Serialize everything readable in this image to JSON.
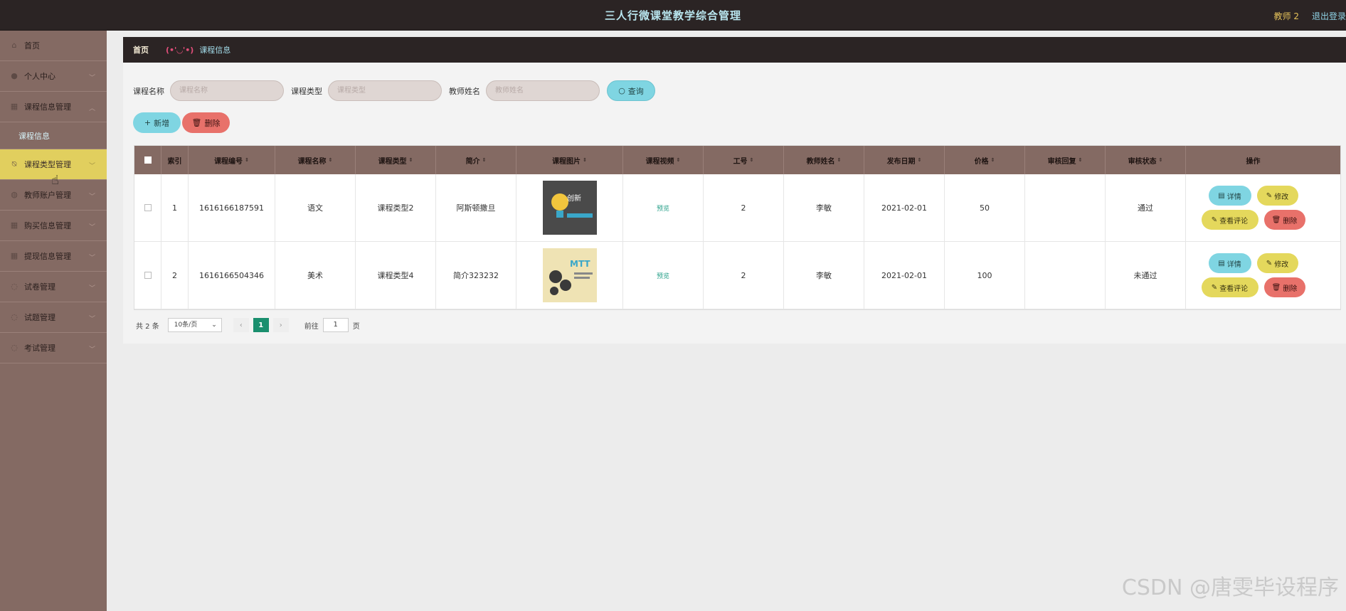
{
  "app": {
    "title": "三人行微课堂教学综合管理",
    "user": "教师 2",
    "logout": "退出登录"
  },
  "sidebar": {
    "items": [
      {
        "label": "首页",
        "icon": "home-icon"
      },
      {
        "label": "个人中心",
        "icon": "user-icon"
      },
      {
        "label": "课程信息管理",
        "icon": "grid-icon"
      },
      {
        "label": "课程信息",
        "icon": ""
      },
      {
        "label": "课程类型管理",
        "icon": "bell-off-icon"
      },
      {
        "label": "教师账户管理",
        "icon": "users-icon"
      },
      {
        "label": "购买信息管理",
        "icon": "grid-icon"
      },
      {
        "label": "提现信息管理",
        "icon": "grid-icon"
      },
      {
        "label": "试卷管理",
        "icon": "doc-icon"
      },
      {
        "label": "试题管理",
        "icon": "doc-icon"
      },
      {
        "label": "考试管理",
        "icon": "doc-icon"
      }
    ]
  },
  "breadcrumb": {
    "home": "首页",
    "face": "(•'◡'•)",
    "current": "课程信息"
  },
  "search": {
    "course_name_label": "课程名称",
    "course_name_placeholder": "课程名称",
    "course_type_label": "课程类型",
    "course_type_placeholder": "课程类型",
    "teacher_name_label": "教师姓名",
    "teacher_name_placeholder": "教师姓名",
    "query_label": "查询"
  },
  "actions": {
    "add_label": "新增",
    "delete_label": "删除"
  },
  "table": {
    "headers": [
      "索引",
      "课程编号",
      "课程名称",
      "课程类型",
      "简介",
      "课程图片",
      "课程视频",
      "工号",
      "教师姓名",
      "发布日期",
      "价格",
      "审核回复",
      "审核状态",
      "操作"
    ],
    "rows": [
      {
        "index": "1",
        "code": "1616166187591",
        "name": "语文",
        "type": "课程类型2",
        "intro": "阿斯顿撒旦",
        "video": "预览",
        "worker_no": "2",
        "teacher": "李敏",
        "date": "2021-02-01",
        "price": "50",
        "reply": "",
        "status": "通过"
      },
      {
        "index": "2",
        "code": "1616166504346",
        "name": "美术",
        "type": "课程类型4",
        "intro": "简介323232",
        "video": "预览",
        "worker_no": "2",
        "teacher": "李敏",
        "date": "2021-02-01",
        "price": "100",
        "reply": "",
        "status": "未通过"
      }
    ],
    "op_detail": "详情",
    "op_edit": "修改",
    "op_comment": "查看评论",
    "op_delete": "删除"
  },
  "pagination": {
    "total": "共 2 条",
    "page_size": "10条/页",
    "current": "1",
    "goto_label": "前往",
    "goto_value": "1",
    "page_suffix": "页"
  },
  "watermark": "CSDN @唐雯毕设程序"
}
